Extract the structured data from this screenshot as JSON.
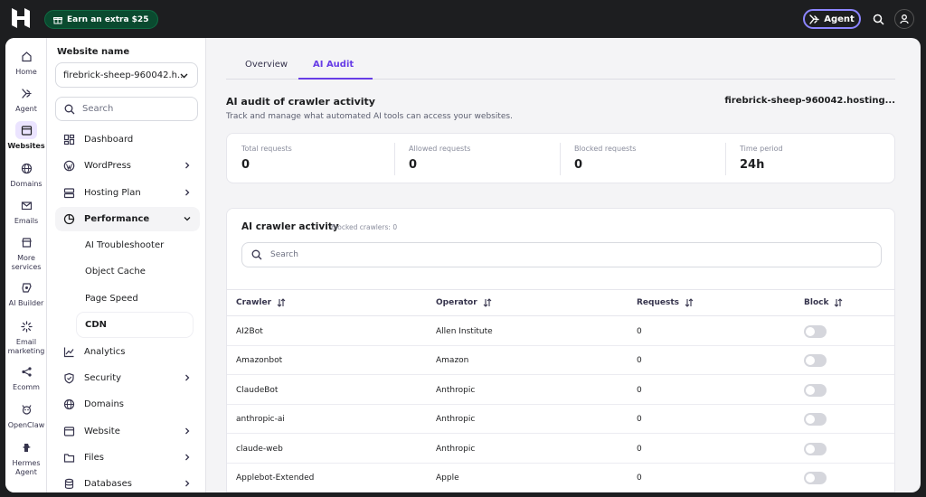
{
  "topbar": {
    "earn_label": "Earn an extra $25",
    "agent_label": "Agent"
  },
  "rail": {
    "items": [
      {
        "label": "Home",
        "icon": "home-icon"
      },
      {
        "label": "Agent",
        "icon": "agent-icon"
      },
      {
        "label": "Websites",
        "icon": "browser-icon"
      },
      {
        "label": "Domains",
        "icon": "globe-icon"
      },
      {
        "label": "Emails",
        "icon": "mail-icon"
      },
      {
        "label": "More",
        "label2": "services",
        "icon": "store-icon"
      },
      {
        "label": "AI Builder",
        "icon": "builder-icon"
      },
      {
        "label": "Email",
        "label2": "marketing",
        "icon": "sparkle-icon"
      },
      {
        "label": "Ecomm",
        "icon": "share-icon"
      },
      {
        "label": "OpenClaw",
        "icon": "claw-icon"
      },
      {
        "label": "Hermes",
        "label2": "Agent",
        "icon": "hermes-icon"
      }
    ]
  },
  "sidebar": {
    "title": "Website name",
    "site": "firebrick-sheep-960042.h...",
    "search_placeholder": "Search",
    "items": [
      {
        "label": "Dashboard"
      },
      {
        "label": "WordPress"
      },
      {
        "label": "Hosting Plan"
      },
      {
        "label": "Performance"
      },
      {
        "label": "Analytics"
      },
      {
        "label": "Security"
      },
      {
        "label": "Domains"
      },
      {
        "label": "Website"
      },
      {
        "label": "Files"
      },
      {
        "label": "Databases"
      }
    ],
    "sub_items": [
      {
        "label": "AI Troubleshooter"
      },
      {
        "label": "Object Cache"
      },
      {
        "label": "Page Speed"
      },
      {
        "label": "CDN"
      }
    ]
  },
  "tabs": [
    {
      "label": "Overview"
    },
    {
      "label": "AI Audit"
    }
  ],
  "audit": {
    "title": "AI audit of crawler activity",
    "host": "firebrick-sheep-960042.hosting...",
    "subtitle": "Track and manage what automated AI tools can access your websites."
  },
  "stats": [
    {
      "label": "Total requests",
      "value": "0"
    },
    {
      "label": "Allowed requests",
      "value": "0"
    },
    {
      "label": "Blocked requests",
      "value": "0"
    },
    {
      "label": "Time period",
      "value": "24h"
    }
  ],
  "activity": {
    "title": "AI crawler activity",
    "blocked": "Blocked crawlers: 0",
    "search_placeholder": "Search",
    "columns": [
      "Crawler",
      "Operator",
      "Requests",
      "Block"
    ],
    "rows": [
      {
        "crawler": "AI2Bot",
        "operator": "Allen Institute",
        "requests": "0"
      },
      {
        "crawler": "Amazonbot",
        "operator": "Amazon",
        "requests": "0"
      },
      {
        "crawler": "ClaudeBot",
        "operator": "Anthropic",
        "requests": "0"
      },
      {
        "crawler": "anthropic-ai",
        "operator": "Anthropic",
        "requests": "0"
      },
      {
        "crawler": "claude-web",
        "operator": "Anthropic",
        "requests": "0"
      },
      {
        "crawler": "Applebot-Extended",
        "operator": "Apple",
        "requests": "0"
      }
    ]
  },
  "colors": {
    "accent": "#673de6",
    "topbar": "#1d1e20",
    "earn_bg": "#0a4a2f"
  }
}
